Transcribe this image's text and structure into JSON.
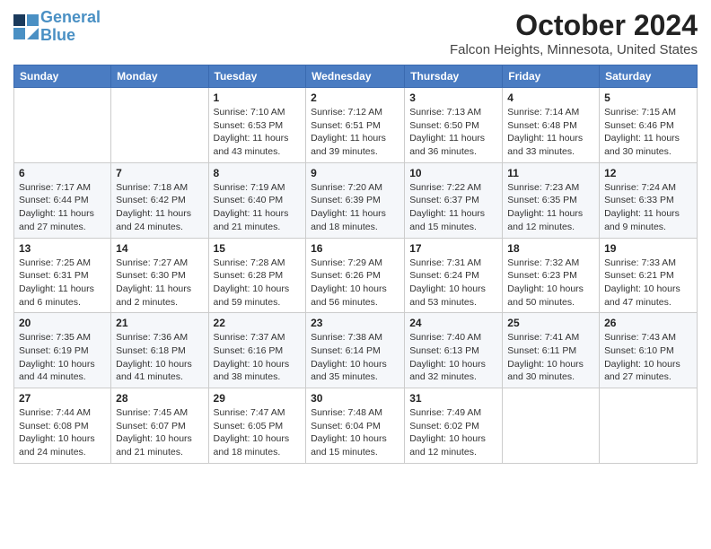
{
  "header": {
    "logo_line1": "General",
    "logo_line2": "Blue",
    "title": "October 2024",
    "subtitle": "Falcon Heights, Minnesota, United States"
  },
  "columns": [
    "Sunday",
    "Monday",
    "Tuesday",
    "Wednesday",
    "Thursday",
    "Friday",
    "Saturday"
  ],
  "weeks": [
    [
      {
        "day": "",
        "info": ""
      },
      {
        "day": "",
        "info": ""
      },
      {
        "day": "1",
        "info": "Sunrise: 7:10 AM\nSunset: 6:53 PM\nDaylight: 11 hours and 43 minutes."
      },
      {
        "day": "2",
        "info": "Sunrise: 7:12 AM\nSunset: 6:51 PM\nDaylight: 11 hours and 39 minutes."
      },
      {
        "day": "3",
        "info": "Sunrise: 7:13 AM\nSunset: 6:50 PM\nDaylight: 11 hours and 36 minutes."
      },
      {
        "day": "4",
        "info": "Sunrise: 7:14 AM\nSunset: 6:48 PM\nDaylight: 11 hours and 33 minutes."
      },
      {
        "day": "5",
        "info": "Sunrise: 7:15 AM\nSunset: 6:46 PM\nDaylight: 11 hours and 30 minutes."
      }
    ],
    [
      {
        "day": "6",
        "info": "Sunrise: 7:17 AM\nSunset: 6:44 PM\nDaylight: 11 hours and 27 minutes."
      },
      {
        "day": "7",
        "info": "Sunrise: 7:18 AM\nSunset: 6:42 PM\nDaylight: 11 hours and 24 minutes."
      },
      {
        "day": "8",
        "info": "Sunrise: 7:19 AM\nSunset: 6:40 PM\nDaylight: 11 hours and 21 minutes."
      },
      {
        "day": "9",
        "info": "Sunrise: 7:20 AM\nSunset: 6:39 PM\nDaylight: 11 hours and 18 minutes."
      },
      {
        "day": "10",
        "info": "Sunrise: 7:22 AM\nSunset: 6:37 PM\nDaylight: 11 hours and 15 minutes."
      },
      {
        "day": "11",
        "info": "Sunrise: 7:23 AM\nSunset: 6:35 PM\nDaylight: 11 hours and 12 minutes."
      },
      {
        "day": "12",
        "info": "Sunrise: 7:24 AM\nSunset: 6:33 PM\nDaylight: 11 hours and 9 minutes."
      }
    ],
    [
      {
        "day": "13",
        "info": "Sunrise: 7:25 AM\nSunset: 6:31 PM\nDaylight: 11 hours and 6 minutes."
      },
      {
        "day": "14",
        "info": "Sunrise: 7:27 AM\nSunset: 6:30 PM\nDaylight: 11 hours and 2 minutes."
      },
      {
        "day": "15",
        "info": "Sunrise: 7:28 AM\nSunset: 6:28 PM\nDaylight: 10 hours and 59 minutes."
      },
      {
        "day": "16",
        "info": "Sunrise: 7:29 AM\nSunset: 6:26 PM\nDaylight: 10 hours and 56 minutes."
      },
      {
        "day": "17",
        "info": "Sunrise: 7:31 AM\nSunset: 6:24 PM\nDaylight: 10 hours and 53 minutes."
      },
      {
        "day": "18",
        "info": "Sunrise: 7:32 AM\nSunset: 6:23 PM\nDaylight: 10 hours and 50 minutes."
      },
      {
        "day": "19",
        "info": "Sunrise: 7:33 AM\nSunset: 6:21 PM\nDaylight: 10 hours and 47 minutes."
      }
    ],
    [
      {
        "day": "20",
        "info": "Sunrise: 7:35 AM\nSunset: 6:19 PM\nDaylight: 10 hours and 44 minutes."
      },
      {
        "day": "21",
        "info": "Sunrise: 7:36 AM\nSunset: 6:18 PM\nDaylight: 10 hours and 41 minutes."
      },
      {
        "day": "22",
        "info": "Sunrise: 7:37 AM\nSunset: 6:16 PM\nDaylight: 10 hours and 38 minutes."
      },
      {
        "day": "23",
        "info": "Sunrise: 7:38 AM\nSunset: 6:14 PM\nDaylight: 10 hours and 35 minutes."
      },
      {
        "day": "24",
        "info": "Sunrise: 7:40 AM\nSunset: 6:13 PM\nDaylight: 10 hours and 32 minutes."
      },
      {
        "day": "25",
        "info": "Sunrise: 7:41 AM\nSunset: 6:11 PM\nDaylight: 10 hours and 30 minutes."
      },
      {
        "day": "26",
        "info": "Sunrise: 7:43 AM\nSunset: 6:10 PM\nDaylight: 10 hours and 27 minutes."
      }
    ],
    [
      {
        "day": "27",
        "info": "Sunrise: 7:44 AM\nSunset: 6:08 PM\nDaylight: 10 hours and 24 minutes."
      },
      {
        "day": "28",
        "info": "Sunrise: 7:45 AM\nSunset: 6:07 PM\nDaylight: 10 hours and 21 minutes."
      },
      {
        "day": "29",
        "info": "Sunrise: 7:47 AM\nSunset: 6:05 PM\nDaylight: 10 hours and 18 minutes."
      },
      {
        "day": "30",
        "info": "Sunrise: 7:48 AM\nSunset: 6:04 PM\nDaylight: 10 hours and 15 minutes."
      },
      {
        "day": "31",
        "info": "Sunrise: 7:49 AM\nSunset: 6:02 PM\nDaylight: 10 hours and 12 minutes."
      },
      {
        "day": "",
        "info": ""
      },
      {
        "day": "",
        "info": ""
      }
    ]
  ]
}
